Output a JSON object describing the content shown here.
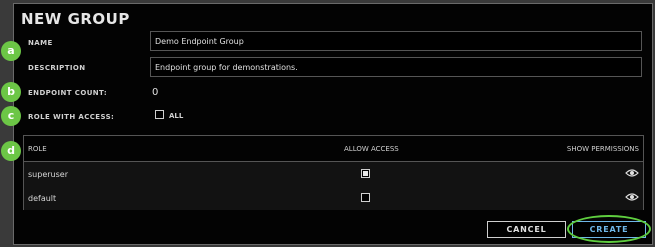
{
  "dialog": {
    "title": "NEW GROUP",
    "name_label": "NAME",
    "name_value": "Demo Endpoint Group",
    "description_label": "DESCRIPTION",
    "description_value": "Endpoint group for demonstrations.",
    "endpoint_count_label": "ENDPOINT COUNT:",
    "endpoint_count_value": "0",
    "role_access_label": "ROLE WITH ACCESS:",
    "all_label": "ALL",
    "all_checked": false
  },
  "table": {
    "headers": {
      "role": "ROLE",
      "allow_access": "ALLOW ACCESS",
      "show_permissions": "SHOW PERMISSIONS"
    },
    "rows": [
      {
        "role": "superuser",
        "allow_access": true,
        "icon": "eye-icon"
      },
      {
        "role": "default",
        "allow_access": false,
        "icon": "eye-icon"
      }
    ]
  },
  "buttons": {
    "cancel": "CANCEL",
    "create": "CREATE"
  },
  "annotations": {
    "markers": [
      "a",
      "b",
      "c",
      "d"
    ],
    "marker_color": "#6cc646",
    "highlight_color": "#5fce3f"
  },
  "colors": {
    "accent": "#6fb6e8",
    "background": "#030303"
  }
}
